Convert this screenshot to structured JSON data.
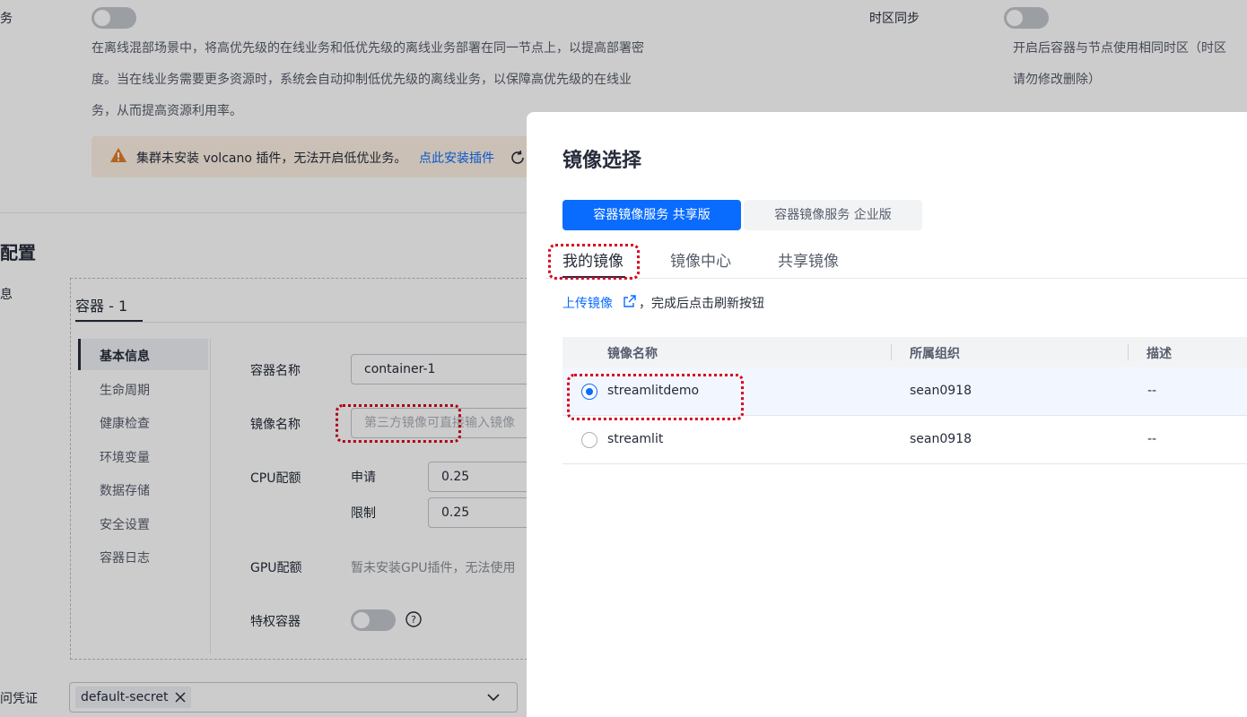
{
  "background": {
    "offline_service_label": "务",
    "offline_desc_lines": [
      "在离线混部场景中，将高优先级的在线业务和低优先级的离线业务部署在同一节点上，以提高部署密",
      "度。当在线业务需要更多资源时，系统会自动抑制低优先级的离线业务，以保障高优先级的在线业",
      "务，从而提高资源利用率。"
    ],
    "timezone_label": "时区同步",
    "timezone_desc_lines": [
      "开启后容器与节点使用相同时区（时区",
      "请勿修改删除）"
    ],
    "warning_text": "集群未安装 volcano 插件，无法开启低优业务。",
    "warning_link": "点此安装插件",
    "section_title": "配置",
    "section_sub": "息",
    "container_tab": "容器 - 1",
    "side_menu": [
      "基本信息",
      "生命周期",
      "健康检查",
      "环境变量",
      "数据存储",
      "安全设置",
      "容器日志"
    ],
    "container_name_label": "容器名称",
    "container_name_value": "container-1",
    "image_name_label": "镜像名称",
    "image_name_placeholder": "第三方镜像可直接输入镜像",
    "cpu_label": "CPU配额",
    "request_label": "申请",
    "request_value": "0.25",
    "limit_label": "限制",
    "limit_value": "0.25",
    "gpu_label": "GPU配额",
    "gpu_text": "暂未安装GPU插件，无法使用",
    "privileged_label": "特权容器",
    "secret_label": "问凭证",
    "secret_tag": "default-secret"
  },
  "drawer": {
    "title": "镜像选择",
    "service_tabs": [
      "容器镜像服务 共享版",
      "容器镜像服务 企业版"
    ],
    "sub_tabs": [
      "我的镜像",
      "镜像中心",
      "共享镜像"
    ],
    "upload_link": "上传镜像",
    "upload_hint": "，完成后点击刷新按钮",
    "table": {
      "headers": [
        "镜像名称",
        "所属组织",
        "描述"
      ],
      "rows": [
        {
          "name": "streamlitdemo",
          "org": "sean0918",
          "desc": "--",
          "selected": true
        },
        {
          "name": "streamlit",
          "org": "sean0918",
          "desc": "--",
          "selected": false
        }
      ]
    }
  },
  "colors": {
    "primary": "#0a6cff",
    "warning": "#e37d29",
    "highlight": "#d9001b"
  }
}
